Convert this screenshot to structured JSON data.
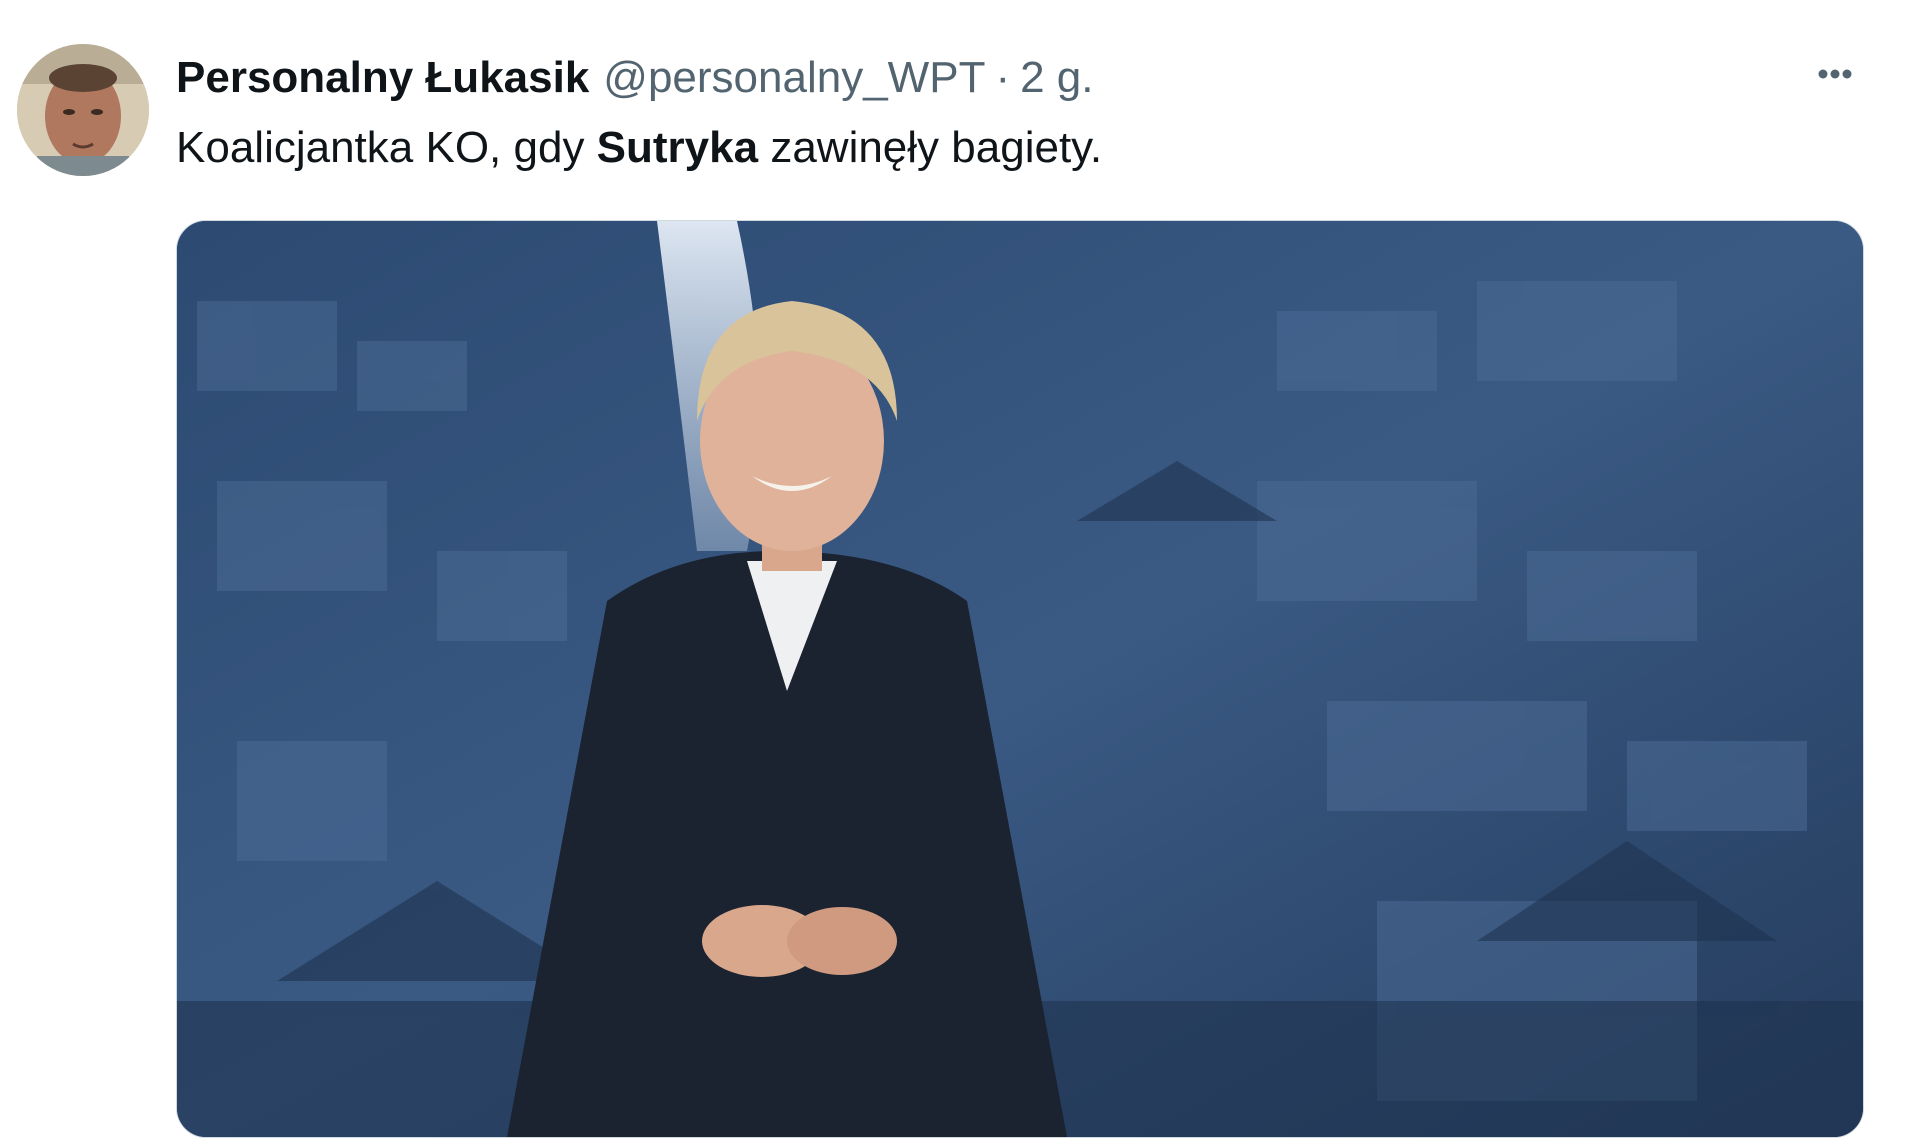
{
  "tweet": {
    "author": {
      "display_name": "Personalny Łukasik",
      "handle": "@personalny_WPT",
      "avatar": "user-avatar-photo"
    },
    "separator": "·",
    "timestamp": "2 g.",
    "more_icon": "more-horizontal-icon",
    "text": {
      "before": "Koalicjantka KO, gdy ",
      "bold": "Sutryka",
      "after": " zawinęły bagiety."
    },
    "media": {
      "type": "video",
      "description_icon": "video-frame"
    }
  },
  "colors": {
    "text_primary": "#0f1419",
    "text_secondary": "#536471",
    "media_background": "#2b4467"
  }
}
